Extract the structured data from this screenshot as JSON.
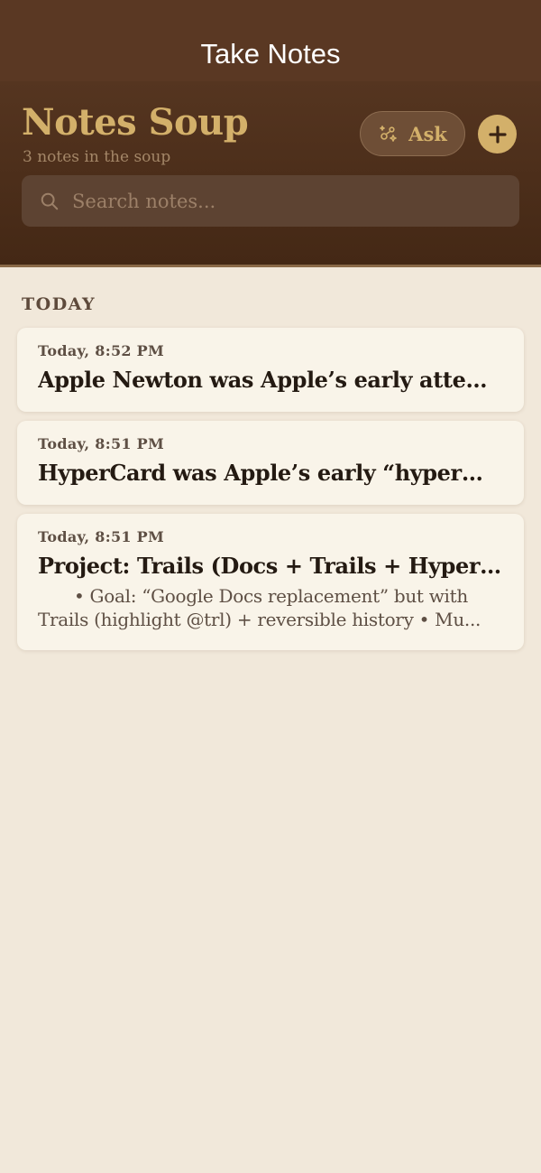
{
  "app": {
    "window_title": "Take Notes",
    "title": "Notes Soup",
    "subtitle": "3 notes in the soup",
    "colors": {
      "accent": "#d3b06a",
      "header_bg": "#4b2e1b",
      "page_bg": "#f1e8da",
      "card_bg": "#f9f4e9"
    }
  },
  "toolbar": {
    "ask_label": "Ask",
    "ask_icon": "sparkles-icon",
    "add_icon": "plus-icon"
  },
  "search": {
    "placeholder": "Search notes...",
    "value": "",
    "icon": "search-icon"
  },
  "sections": [
    {
      "title": "TODAY",
      "notes": [
        {
          "time": "Today, 8:52 PM",
          "title": "Apple Newton was Apple’s early attempt..."
        },
        {
          "time": "Today, 8:51 PM",
          "title": "HyperCard was Apple’s early “hyperme..."
        },
        {
          "time": "Today, 8:51 PM",
          "title": "Project: Trails (Docs + Trails + HyperCar...",
          "preview_line1": "•     Goal: “Google Docs replacement” but with",
          "preview_line2": "Trails (highlight @trl) + reversible history   •     Mu..."
        }
      ]
    }
  ]
}
